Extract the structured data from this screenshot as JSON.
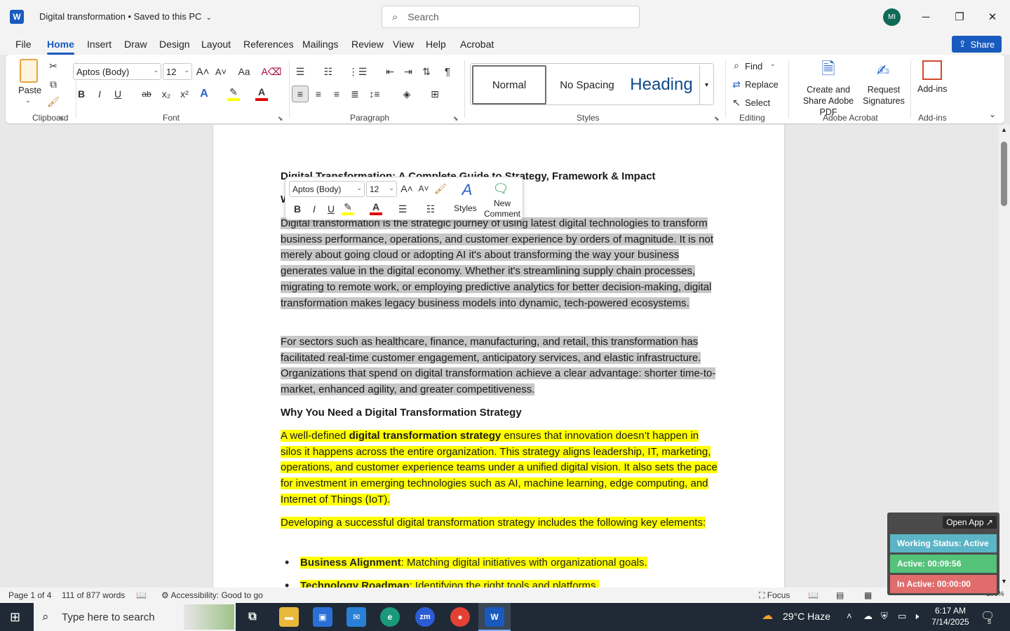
{
  "window": {
    "doc_title": "Digital transformation • Saved to this PC",
    "search_placeholder": "Search",
    "avatar_initials": "MI",
    "share_label": "Share"
  },
  "menu": [
    "File",
    "Home",
    "Insert",
    "Draw",
    "Design",
    "Layout",
    "References",
    "Mailings",
    "Review",
    "View",
    "Help",
    "Acrobat"
  ],
  "ribbon": {
    "clipboard": {
      "paste": "Paste",
      "label": "Clipboard"
    },
    "font": {
      "name": "Aptos (Body)",
      "size": "12",
      "label": "Font",
      "bold": "B",
      "italic": "I",
      "underline": "U",
      "strike": "ab",
      "sub": "x₂",
      "sup": "x²",
      "case": "Aa"
    },
    "paragraph": {
      "label": "Paragraph"
    },
    "styles": {
      "label": "Styles",
      "items": [
        "Normal",
        "No Spacing",
        "Heading"
      ]
    },
    "editing": {
      "find": "Find",
      "replace": "Replace",
      "select": "Select",
      "label": "Editing"
    },
    "acrobat": {
      "create": "Create and Share Adobe PDF",
      "request": "Request Signatures",
      "label": "Adobe Acrobat"
    },
    "addins": {
      "btn": "Add-ins",
      "label": "Add-ins"
    }
  },
  "mini_toolbar": {
    "font": "Aptos (Body)",
    "size": "12",
    "styles": "Styles",
    "new_comment": "New Comment"
  },
  "document": {
    "title_line": "Digital Transformation: A Complete Guide to Strategy, Framework & Impact",
    "line2": "W",
    "para1": "Digital transformation is the strategic journey of using latest digital technologies to transform business performance, operations, and customer experience by orders of magnitude. It is not merely about going cloud or adopting AI it's about transforming the way your business generates value in the digital economy. Whether it's streamlining supply chain processes, migrating to remote work, or employing predictive analytics for better decision-making, digital transformation makes legacy business models into dynamic, tech-powered ecosystems.",
    "para2": "For sectors such as healthcare, finance, manufacturing, and retail, this transformation has facilitated real-time customer engagement, anticipatory services, and elastic infrastructure. Organizations that spend on digital transformation achieve a clear advantage: shorter time-to-market, enhanced agility, and greater competitiveness.",
    "heading": "Why You Need a Digital Transformation Strategy",
    "para3_pre": "A well-defined ",
    "para3_bold": "digital transformation strategy",
    "para3_post": " ensures that innovation doesn’t happen in silos it happens across the entire organization. This strategy aligns leadership, IT, marketing, operations, and customer experience teams under a unified digital vision. It also sets the pace for investment in emerging technologies such as AI, machine learning, edge computing, and Internet of Things (IoT).",
    "para4": "Developing a successful digital transformation strategy includes the following key elements:",
    "bullets": [
      {
        "bold": "Business Alignment",
        "rest": ": Matching digital initiatives with organizational goals."
      },
      {
        "bold": "Technology Roadmap",
        "rest": ": Identifying the right tools and platforms."
      }
    ]
  },
  "statusbar": {
    "page": "Page 1 of 4",
    "words": "111 of 877 words",
    "accessibility": "Accessibility: Good to go",
    "focus": "Focus",
    "zoom": "100%"
  },
  "widget": {
    "open": "Open App ↗",
    "working": "Working Status: Active",
    "active": "Active: 00:09:56",
    "inactive": "In Active: 00:00:00"
  },
  "taskbar": {
    "search": "Type here to search",
    "weather": "29°C  Haze",
    "time": "6:17 AM",
    "date": "7/14/2025",
    "notif": "5"
  },
  "colors": {
    "accent": "#185abd",
    "selection": "#c7c7c7",
    "highlight": "#ffff00",
    "w_working": "#5bb5c6",
    "w_active": "#55c27a",
    "w_inactive": "#e06c6c"
  }
}
